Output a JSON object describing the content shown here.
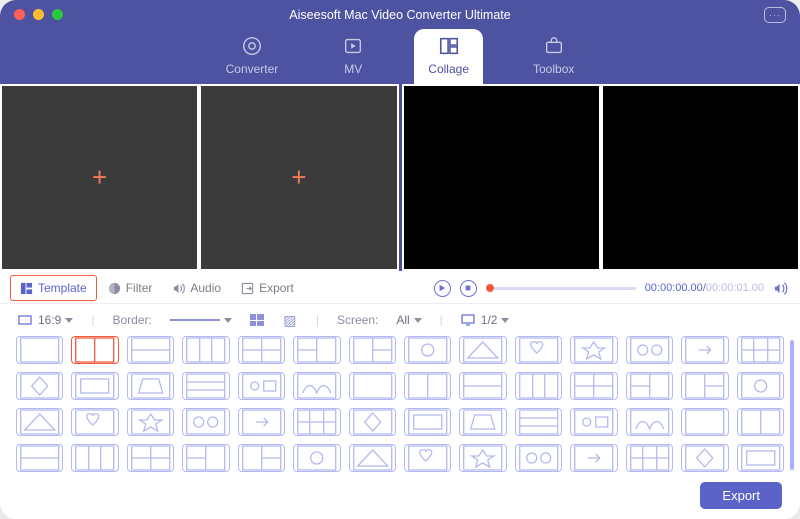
{
  "app": {
    "title": "Aiseesoft Mac Video Converter Ultimate"
  },
  "nav": {
    "items": [
      {
        "label": "Converter",
        "active": false
      },
      {
        "label": "MV",
        "active": false
      },
      {
        "label": "Collage",
        "active": true
      },
      {
        "label": "Toolbox",
        "active": false
      }
    ]
  },
  "subtabs": {
    "template": "Template",
    "filter": "Filter",
    "audio": "Audio",
    "export": "Export",
    "active": "template"
  },
  "player": {
    "current_time": "00:00:00.00",
    "total_time": "00:00:01.00"
  },
  "options": {
    "aspect": "16:9",
    "border_label": "Border:",
    "screen_label": "Screen:",
    "screen_value": "All",
    "layer_value": "1/2"
  },
  "templates": {
    "rows": 4,
    "cols": 14,
    "selected_index": 1
  },
  "footer": {
    "export_label": "Export"
  }
}
